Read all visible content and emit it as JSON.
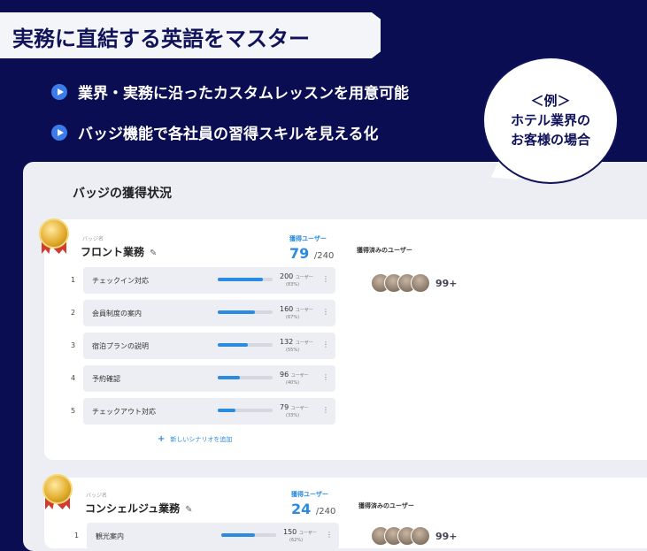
{
  "hero": {
    "title": "実務に直結する英語をマスター",
    "bullets": [
      "業界・実務に沿ったカスタムレッスンを用意可能",
      "バッジ機能で各社員の習得スキルを見える化"
    ],
    "callout": [
      "＜例＞",
      "ホテル業界の",
      "お客様の場合"
    ]
  },
  "panel": {
    "title": "バッジの獲得状況",
    "badges": [
      {
        "caption": "バッジ名",
        "name": "フロント業務",
        "acquired_label": "獲得ユーザー",
        "acquired": "79",
        "total": "/240",
        "users_label": "獲得済みのユーザー",
        "users_more": "99+",
        "scenarios": [
          {
            "no": "1",
            "name": "チェックイン対応",
            "count": "200",
            "unit": "ユーザー",
            "pct": "(83%)",
            "ratio": 0.83
          },
          {
            "no": "2",
            "name": "会員制度の案内",
            "count": "160",
            "unit": "ユーザー",
            "pct": "(67%)",
            "ratio": 0.67
          },
          {
            "no": "3",
            "name": "宿泊プランの説明",
            "count": "132",
            "unit": "ユーザー",
            "pct": "(55%)",
            "ratio": 0.55
          },
          {
            "no": "4",
            "name": "予約確認",
            "count": "96",
            "unit": "ユーザー",
            "pct": "(40%)",
            "ratio": 0.4
          },
          {
            "no": "5",
            "name": "チェックアウト対応",
            "count": "79",
            "unit": "ユーザー",
            "pct": "(33%)",
            "ratio": 0.33
          }
        ],
        "add_label": "新しいシナリオを追加"
      },
      {
        "caption": "バッジ名",
        "name": "コンシェルジュ業務",
        "acquired_label": "獲得ユーザー",
        "acquired": "24",
        "total": "/240",
        "users_label": "獲得済みのユーザー",
        "users_more": "99+",
        "scenarios": [
          {
            "no": "1",
            "name": "観光案内",
            "count": "150",
            "unit": "ユーザー",
            "pct": "(62%)",
            "ratio": 0.62
          }
        ]
      }
    ]
  },
  "colors": {
    "navy": "#0b0d52",
    "accent": "#2a8be0",
    "bullet": "#3b7bea"
  }
}
